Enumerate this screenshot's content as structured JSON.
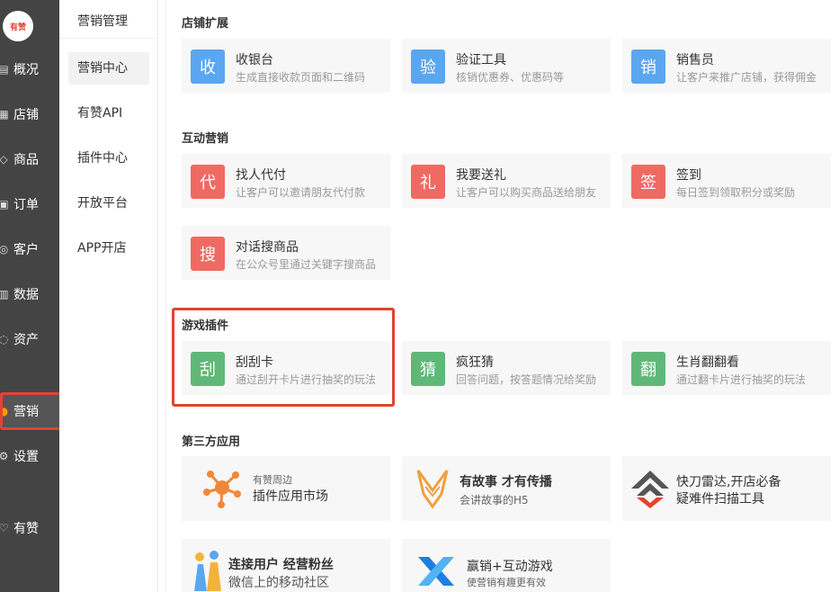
{
  "logo": {
    "text": "有赞"
  },
  "sidebar": {
    "items": [
      {
        "label": "概况",
        "icon": "overview-icon",
        "glyph": "▤"
      },
      {
        "label": "店铺",
        "icon": "shop-icon",
        "glyph": "▦"
      },
      {
        "label": "商品",
        "icon": "tag-icon",
        "glyph": "◇"
      },
      {
        "label": "订单",
        "icon": "order-icon",
        "glyph": "▣"
      },
      {
        "label": "客户",
        "icon": "user-icon",
        "glyph": "◎"
      },
      {
        "label": "数据",
        "icon": "chart-icon",
        "glyph": "▥"
      },
      {
        "label": "资产",
        "icon": "asset-icon",
        "glyph": "◌"
      },
      {
        "label": "营销",
        "icon": "marketing-icon",
        "glyph": "●"
      },
      {
        "label": "设置",
        "icon": "gear-icon",
        "glyph": "⚙"
      },
      {
        "label": "有赞",
        "icon": "thumb-icon",
        "glyph": "♡"
      }
    ]
  },
  "subnav": {
    "title": "营销管理",
    "items": [
      "营销中心",
      "有赞API",
      "插件中心",
      "开放平台",
      "APP开店"
    ]
  },
  "sections": {
    "shop": {
      "title": "店铺扩展",
      "cards": [
        {
          "badge": "收",
          "title": "收银台",
          "desc": "生成直接收款页面和二维码"
        },
        {
          "badge": "验",
          "title": "验证工具",
          "desc": "核销优惠券、优惠码等"
        },
        {
          "badge": "销",
          "title": "销售员",
          "desc": "让客户来推广店铺，获得佣金"
        }
      ]
    },
    "interactive": {
      "title": "互动营销",
      "cards": [
        {
          "badge": "代",
          "title": "找人代付",
          "desc": "让客户可以邀请朋友代付款"
        },
        {
          "badge": "礼",
          "title": "我要送礼",
          "desc": "让客户可以购买商品送给朋友"
        },
        {
          "badge": "签",
          "title": "签到",
          "desc": "每日签到领取积分或奖励"
        },
        {
          "badge": "搜",
          "title": "对话搜商品",
          "desc": "在公众号里通过关键字搜商品"
        }
      ]
    },
    "games": {
      "title": "游戏插件",
      "cards": [
        {
          "badge": "刮",
          "title": "刮刮卡",
          "desc": "通过刮开卡片进行抽奖的玩法"
        },
        {
          "badge": "猜",
          "title": "疯狂猜",
          "desc": "回答问题，按答题情况给奖励"
        },
        {
          "badge": "翻",
          "title": "生肖翻翻看",
          "desc": "通过翻卡片进行抽奖的玩法"
        }
      ]
    },
    "thirdparty": {
      "title": "第三方应用",
      "cards": [
        {
          "line1": "有赞周边",
          "line2": "插件应用市场",
          "icon": "network-icon"
        },
        {
          "line1": "有故事 才有传播",
          "line2": "会讲故事的H5",
          "icon": "fox-icon"
        },
        {
          "line1": "快刀雷达,开店必备",
          "line2": "疑难件扫描工具",
          "icon": "radar-icon"
        },
        {
          "line1": "连接用户 经营粉丝",
          "line2": "微信上的移动社区",
          "icon": "people-icon"
        },
        {
          "line1": "赢销+互动游戏",
          "line2": "使营销有趣更有效",
          "icon": "x-logo-icon"
        }
      ]
    }
  }
}
